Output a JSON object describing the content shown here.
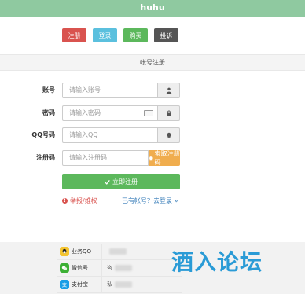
{
  "header": {
    "title": "huhu"
  },
  "buttons": {
    "register": "注册",
    "login": "登录",
    "buy": "购买",
    "complain": "投诉"
  },
  "section": {
    "title": "帐号注册"
  },
  "form": {
    "account": {
      "label": "账号",
      "placeholder": "请输入账号",
      "icon": "user-icon"
    },
    "password": {
      "label": "密码",
      "placeholder": "请输入密码",
      "icon": "lock-icon"
    },
    "qq": {
      "label": "QQ号码",
      "placeholder": "请输入QQ",
      "icon": "qq-icon"
    },
    "regcode": {
      "label": "注册码",
      "placeholder": "请输入注册码",
      "button": "索取注册码"
    }
  },
  "submit_label": "立即注册",
  "links": {
    "report": "举报/维权",
    "login": "已有帐号？去登录 »"
  },
  "contacts": [
    {
      "name": "业务QQ",
      "value": "",
      "icon": "qq-icon"
    },
    {
      "name": "微信号",
      "value": "咨",
      "icon": "wechat-icon"
    },
    {
      "name": "支付宝",
      "value": "私",
      "icon": "alipay-icon"
    }
  ],
  "watermark": "酒入论坛",
  "colors": {
    "header": "#8fc9a0",
    "red": "#d9534f",
    "blue": "#5bc0de",
    "green": "#5cb85c",
    "dark": "#555555",
    "orange": "#f0ad4e"
  }
}
